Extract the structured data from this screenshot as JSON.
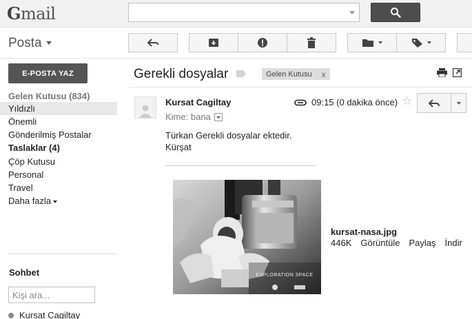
{
  "header": {
    "logo_text": "Gmail",
    "search": {
      "placeholder": "",
      "value": ""
    }
  },
  "toolbar": {
    "mode_label": "Posta",
    "buttons": [
      "reply-arrow-icon",
      "archive-icon",
      "spam-icon",
      "trash-icon",
      "folder-icon",
      "label-icon"
    ]
  },
  "sidebar": {
    "compose_label": "E-POSTA YAZ",
    "items": [
      {
        "label": "Gelen Kutusu (834)"
      },
      {
        "label": "Yıldızlı"
      },
      {
        "label": "Önemli"
      },
      {
        "label": "Gönderilmiş Postalar"
      },
      {
        "label": "Taslaklar (4)"
      },
      {
        "label": "Çöp Kutusu"
      },
      {
        "label": "Personal"
      },
      {
        "label": "Travel"
      },
      {
        "label": "Daha fazla"
      }
    ],
    "chat": {
      "title": "Sohbet",
      "search_placeholder": "Kişi ara...",
      "contact": "Kursat Cagiltay"
    }
  },
  "thread": {
    "subject": "Gerekli dosyalar",
    "label_chip": "Gelen Kutusu",
    "label_chip_close": "x"
  },
  "message": {
    "sender": "Kursat Cagiltay",
    "to_prefix": "Kime:",
    "to_value": "bana",
    "time": "09:15 (0 dakika önce)",
    "body_line1": "Türkan Gerekli dosyalar ektedir.",
    "body_line2": "Kürşat"
  },
  "attachment": {
    "filename": "kursat-nasa.jpg",
    "size": "446K",
    "view": "Görüntüle",
    "share": "Paylaş",
    "download": "İndir",
    "image_caption": "EXPLORATION SPACE"
  },
  "colors": {
    "compose_bg": "#555555",
    "search_button_bg": "#4d4d4d",
    "selected_row_bg": "#e8e8e8"
  }
}
